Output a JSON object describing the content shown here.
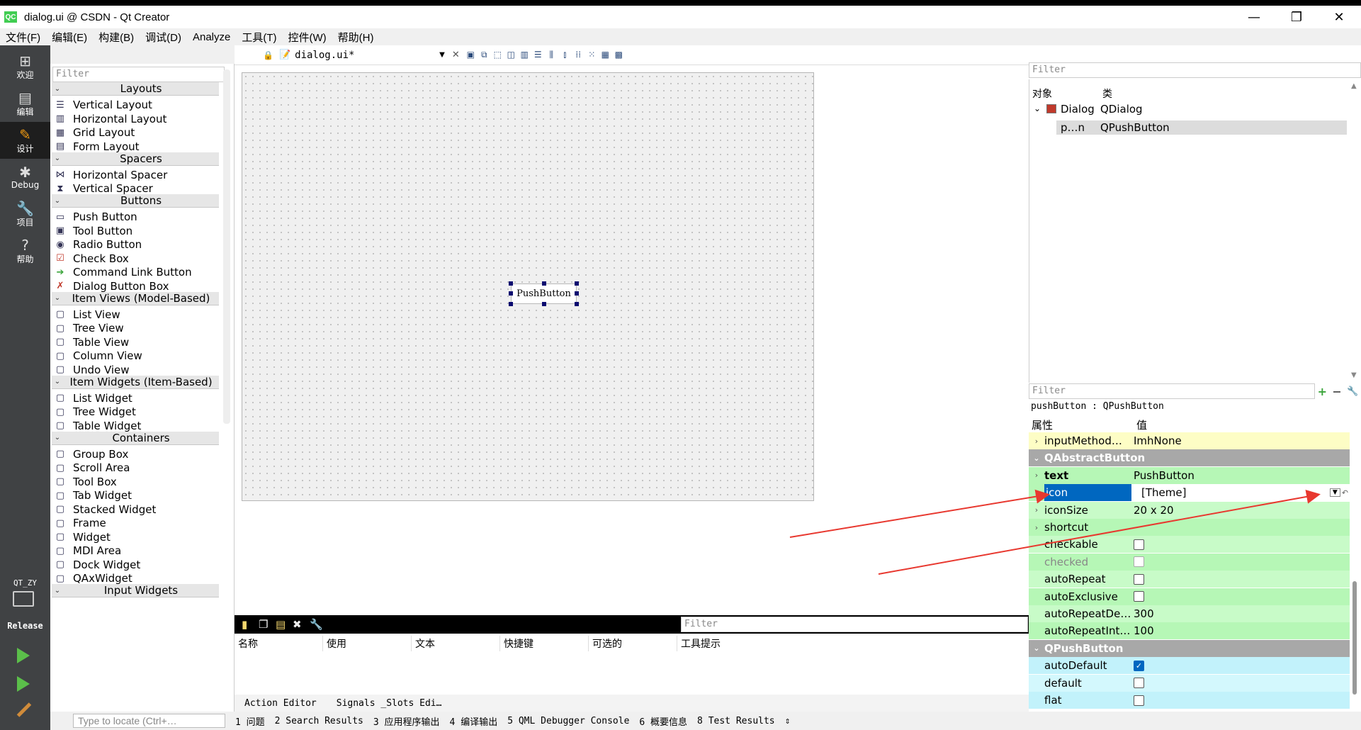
{
  "window": {
    "title": "dialog.ui @ CSDN - Qt Creator",
    "app_icon_text": "QC",
    "min": "—",
    "max": "❐",
    "close": "✕"
  },
  "menubar": [
    "文件(F)",
    "编辑(E)",
    "构建(B)",
    "调试(D)",
    "Analyze",
    "工具(T)",
    "控件(W)",
    "帮助(H)"
  ],
  "modes": [
    {
      "label": "欢迎",
      "icon": "grid-icon",
      "glyph": "⊞"
    },
    {
      "label": "编辑",
      "icon": "document-icon",
      "glyph": "▤"
    },
    {
      "label": "设计",
      "icon": "pencil-icon",
      "glyph": "✎"
    },
    {
      "label": "Debug",
      "icon": "bug-icon",
      "glyph": "✱"
    },
    {
      "label": "项目",
      "icon": "wrench-icon",
      "glyph": "🔧"
    },
    {
      "label": "帮助",
      "icon": "help-icon",
      "glyph": "?"
    }
  ],
  "kit": {
    "name": "QT_ZY",
    "mode": "Release"
  },
  "document": {
    "filename": "dialog.ui*"
  },
  "widgetbox": {
    "filter_placeholder": "Filter",
    "sections": [
      {
        "title": "Layouts",
        "items": [
          "Vertical Layout",
          "Horizontal Layout",
          "Grid Layout",
          "Form Layout"
        ]
      },
      {
        "title": "Spacers",
        "items": [
          "Horizontal Spacer",
          "Vertical Spacer"
        ]
      },
      {
        "title": "Buttons",
        "items": [
          "Push Button",
          "Tool Button",
          "Radio Button",
          "Check Box",
          "Command Link Button",
          "Dialog Button Box"
        ]
      },
      {
        "title": "Item Views (Model-Based)",
        "items": [
          "List View",
          "Tree View",
          "Table View",
          "Column View",
          "Undo View"
        ]
      },
      {
        "title": "Item Widgets (Item-Based)",
        "items": [
          "List Widget",
          "Tree Widget",
          "Table Widget"
        ]
      },
      {
        "title": "Containers",
        "items": [
          "Group Box",
          "Scroll Area",
          "Tool Box",
          "Tab Widget",
          "Stacked Widget",
          "Frame",
          "Widget",
          "MDI Area",
          "Dock Widget",
          "QAxWidget"
        ]
      },
      {
        "title": "Input Widgets",
        "items": []
      }
    ]
  },
  "canvas": {
    "button_text": "PushButton"
  },
  "action_editor": {
    "filter_placeholder": "Filter",
    "columns": [
      "名称",
      "使用",
      "文本",
      "快捷键",
      "可选的",
      "工具提示"
    ],
    "tabs": [
      "Action Editor",
      "Signals _Slots Edi…"
    ]
  },
  "object_inspector": {
    "filter_placeholder": "Filter",
    "col_object": "对象",
    "col_class": "类",
    "rows": [
      {
        "object": "Dialog",
        "class": "QDialog"
      },
      {
        "object": "p…n",
        "class": "QPushButton"
      }
    ]
  },
  "property_editor": {
    "filter_placeholder": "Filter",
    "class_line": "pushButton : QPushButton",
    "col_property": "属性",
    "col_value": "值",
    "rows": [
      {
        "name": "inputMethod…",
        "value": "ImhNone",
        "type": "text",
        "bg": "#fdfdc5",
        "exp": "›"
      },
      {
        "name": "QAbstractButton",
        "type": "group"
      },
      {
        "name": "text",
        "value": "PushButton",
        "type": "text",
        "bg": "#b6f7b6",
        "bold": true,
        "exp": "›"
      },
      {
        "name": "icon",
        "value": "[Theme]",
        "type": "icon",
        "bg": "#b6f7b6",
        "exp": "›",
        "selected": true
      },
      {
        "name": "iconSize",
        "value": "20 x 20",
        "type": "text",
        "bg": "#c8fbc8",
        "exp": "›"
      },
      {
        "name": "shortcut",
        "value": "",
        "type": "text",
        "bg": "#b6f7b6",
        "exp": "›"
      },
      {
        "name": "checkable",
        "type": "check",
        "checked": false,
        "bg": "#c8fbc8"
      },
      {
        "name": "checked",
        "type": "check",
        "checked": false,
        "bg": "#b6f7b6",
        "disabled": true
      },
      {
        "name": "autoRepeat",
        "type": "check",
        "checked": false,
        "bg": "#c8fbc8"
      },
      {
        "name": "autoExclusive",
        "type": "check",
        "checked": false,
        "bg": "#b6f7b6"
      },
      {
        "name": "autoRepeatDe…",
        "value": "300",
        "type": "text",
        "bg": "#c8fbc8"
      },
      {
        "name": "autoRepeatInt…",
        "value": "100",
        "type": "text",
        "bg": "#b6f7b6"
      },
      {
        "name": "QPushButton",
        "type": "group"
      },
      {
        "name": "autoDefault",
        "type": "check",
        "checked": true,
        "bg": "#c2f2fb"
      },
      {
        "name": "default",
        "type": "check",
        "checked": false,
        "bg": "#d3f8fd"
      },
      {
        "name": "flat",
        "type": "check",
        "checked": false,
        "bg": "#c2f2fb"
      }
    ]
  },
  "statusbar": {
    "locate_placeholder": "Type to locate (Ctrl+…",
    "panes": [
      "1 问题",
      "2 Search Results",
      "3 应用程序输出",
      "4 编译输出",
      "5 QML Debugger Console",
      "6 概要信息",
      "8 Test Results"
    ],
    "updown": "⇕"
  },
  "colors": {
    "accent": "#0067c0",
    "arrow": "#e8382f",
    "mode_bar": "#404244",
    "run_green": "#5bbf4a"
  }
}
